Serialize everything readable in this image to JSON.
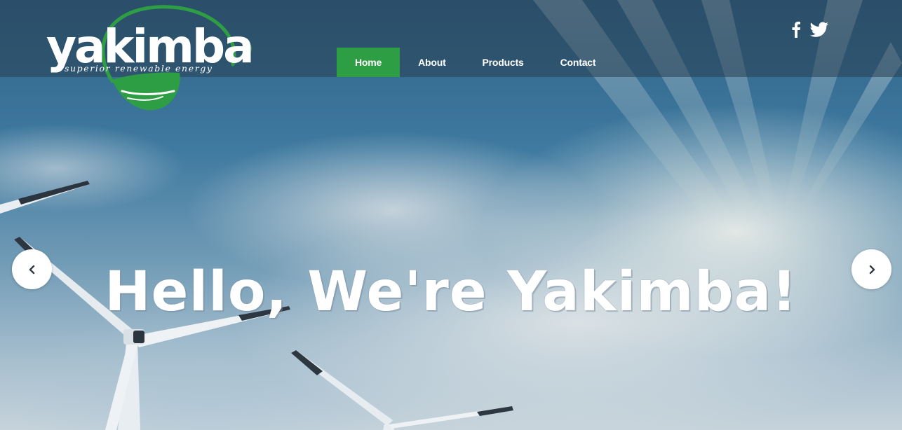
{
  "brand": {
    "name": "yakimba",
    "tagline": "superior renewable energy",
    "accent": "#2e9e45"
  },
  "nav": {
    "items": [
      {
        "label": "Home",
        "active": true
      },
      {
        "label": "About",
        "active": false
      },
      {
        "label": "Products",
        "active": false
      },
      {
        "label": "Contact",
        "active": false
      }
    ]
  },
  "social": {
    "icons": [
      "facebook-icon",
      "twitter-icon"
    ]
  },
  "hero": {
    "title": "Hello, We're Yakimba!",
    "prev_icon": "chevron-left-icon",
    "next_icon": "chevron-right-icon"
  }
}
